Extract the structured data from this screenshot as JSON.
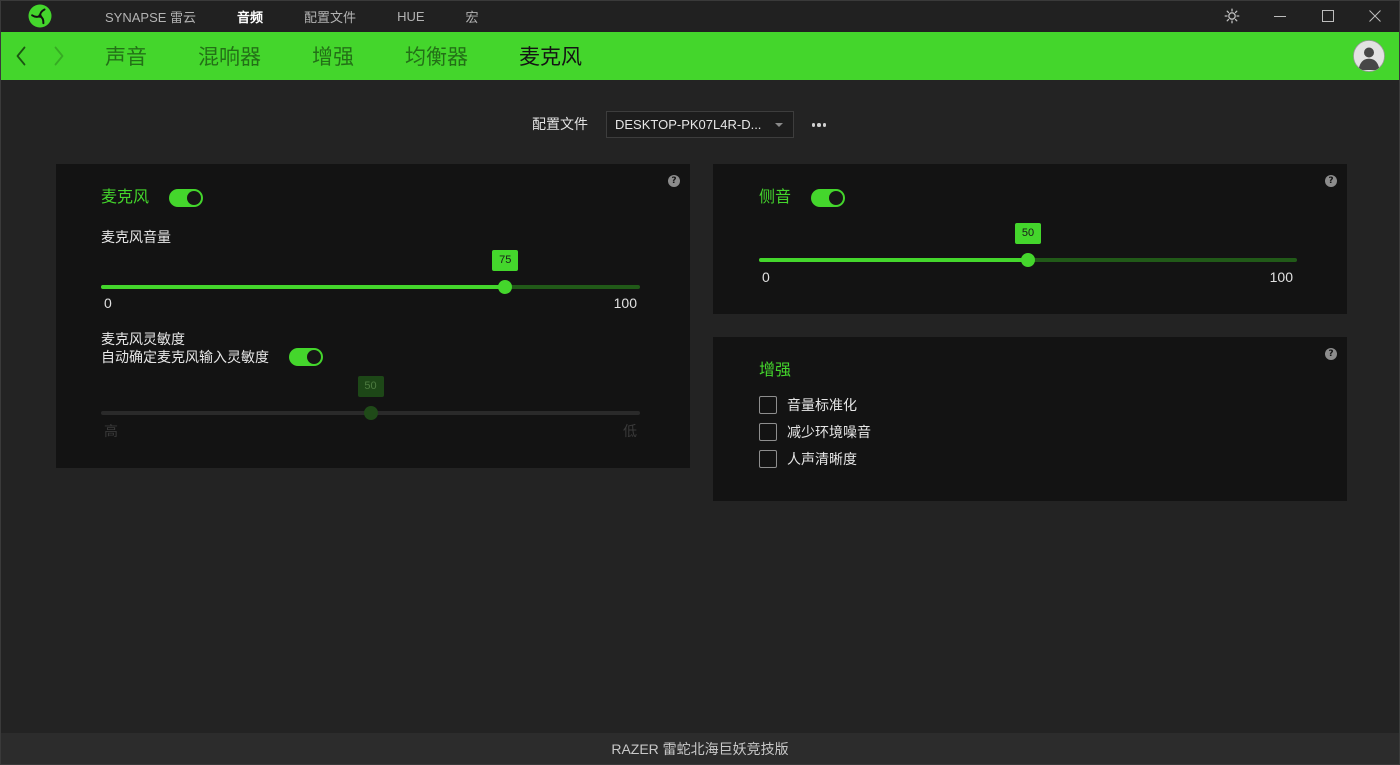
{
  "colors": {
    "accent": "#44d62c",
    "accent_track": "#215a18",
    "background": "#232323",
    "panel": "#131313"
  },
  "titlebar": {
    "logo_icon": "razer-logo-icon",
    "menu": [
      {
        "label": "SYNAPSE 雷云",
        "active": false
      },
      {
        "label": "音频",
        "active": true
      },
      {
        "label": "配置文件",
        "active": false
      },
      {
        "label": "HUE",
        "active": false
      },
      {
        "label": "宏",
        "active": false
      }
    ],
    "control_icons": [
      "gear-icon",
      "minimize-icon",
      "maximize-icon",
      "close-icon"
    ]
  },
  "nav": {
    "back_icon": "chevron-left-icon",
    "forward_icon": "chevron-right-icon",
    "forward_enabled": false,
    "tabs": [
      {
        "label": "声音",
        "active": false
      },
      {
        "label": "混响器",
        "active": false
      },
      {
        "label": "增强",
        "active": false
      },
      {
        "label": "均衡器",
        "active": false
      },
      {
        "label": "麦克风",
        "active": true
      }
    ],
    "avatar_icon": "user-avatar-icon"
  },
  "profile": {
    "label": "配置文件",
    "selected": "DESKTOP-PK07L4R-D...",
    "more_icon": "more-horizontal-icon"
  },
  "microphone": {
    "title": "麦克风",
    "enabled": true,
    "help_icon": "help-icon",
    "volume": {
      "label": "麦克风音量",
      "value": 75,
      "min_label": "0",
      "max_label": "100"
    },
    "sensitivity": {
      "label": "麦克风灵敏度",
      "auto_label": "自动确定麦克风输入灵敏度",
      "auto": true,
      "value": 50,
      "disabled": true,
      "min_label": "高",
      "max_label": "低"
    }
  },
  "sidetone": {
    "title": "侧音",
    "enabled": true,
    "help_icon": "help-icon",
    "value": 50,
    "min_label": "0",
    "max_label": "100"
  },
  "enhancement": {
    "title": "增强",
    "help_icon": "help-icon",
    "options": [
      {
        "label": "音量标准化",
        "checked": false
      },
      {
        "label": "减少环境噪音",
        "checked": false
      },
      {
        "label": "人声清晰度",
        "checked": false
      }
    ]
  },
  "footer": {
    "device_name": "RAZER 雷蛇北海巨妖竞技版"
  }
}
